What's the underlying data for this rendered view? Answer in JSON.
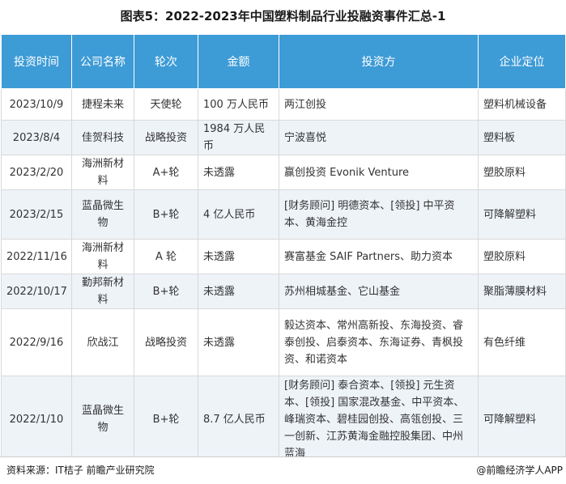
{
  "title": "图表5：2022-2023年中国塑料制品行业投融资事件汇总-1",
  "table": {
    "headers": [
      "投资时间",
      "公司名称",
      "轮次",
      "金额",
      "投资方",
      "企业定位"
    ],
    "rows": [
      [
        "2023/10/9",
        "捷程未来",
        "天使轮",
        "100 万人民币",
        "两江创投",
        "塑料机械设备"
      ],
      [
        "2023/8/4",
        "佳贺科技",
        "战略投资",
        "1984 万人民币",
        "宁波喜悦",
        "塑料板"
      ],
      [
        "2023/2/20",
        "海洲新材料",
        "A+轮",
        "未透露",
        "赢创投资 Evonik Venture",
        "塑胶原料"
      ],
      [
        "2023/2/15",
        "蓝晶微生物",
        "B+轮",
        "4 亿人民币",
        "[财务顾问] 明德资本、[领投] 中平资本、黄海金控",
        "可降解塑料"
      ],
      [
        "2022/11/16",
        "海洲新材料",
        "A 轮",
        "未透露",
        "赛富基金 SAIF Partners、助力资本",
        "塑胶原料"
      ],
      [
        "2022/10/17",
        "勤邦新材料",
        "B+轮",
        "未透露",
        "苏州相城基金、它山基金",
        "聚脂薄膜材料"
      ],
      [
        "2022/9/16",
        "欣战江",
        "战略投资",
        "未透露",
        "毅达资本、常州高新投、东海投资、睿泰创投、启泰资本、东海证券、青枫投资、和诺资本",
        "有色纤维"
      ],
      [
        "2022/1/10",
        "蓝晶微生物",
        "B+轮",
        "8.7 亿人民币",
        "[财务顾问] 泰合资本、[领投] 元生资本、[领投] 国家混改基金、中平资本、峰瑞资本、碧桂园创投、高瓴创投、三一创新、江苏黄海金融控股集团、中州蓝海",
        "可降解塑料"
      ]
    ]
  },
  "footer": {
    "source": "资料来源：IT桔子 前瞻产业研究院",
    "brand": "@前瞻经济学人APP"
  },
  "colors": {
    "header_bg": "#3d9bd6",
    "alt_row_bg": "#eef3f8",
    "border": "#d9d9d9"
  }
}
